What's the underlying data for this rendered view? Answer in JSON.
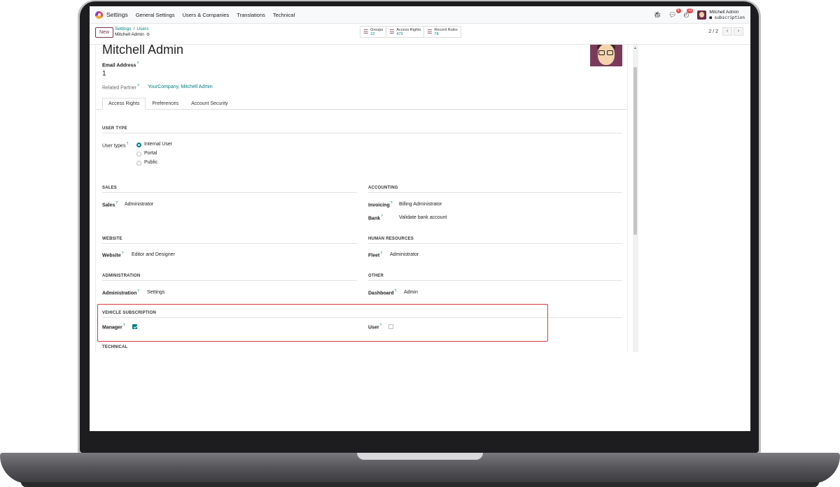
{
  "navbar": {
    "app_title": "Settings",
    "menu": [
      "General Settings",
      "Users & Companies",
      "Translations",
      "Technical"
    ],
    "chat_badge": "6",
    "activity_badge": "11",
    "user_name": "Mitchell Admin",
    "database": "subscription"
  },
  "control": {
    "new_label": "New",
    "breadcrumb_parent_1": "Settings",
    "breadcrumb_parent_2": "Users",
    "breadcrumb_current": "Mitchell Admin",
    "smart_buttons": [
      {
        "label": "Groups",
        "value": "22",
        "icon": "users-icon"
      },
      {
        "label": "Access Rights",
        "value": "473",
        "icon": "list-icon"
      },
      {
        "label": "Record Rules",
        "value": "78",
        "icon": "list-icon"
      }
    ],
    "pager": "2 / 2"
  },
  "form": {
    "name": "Mitchell Admin",
    "email_label": "Email Address",
    "email_value": "1",
    "partner_label": "Related Partner",
    "partner_value": "YourCompany, Mitchell Admin",
    "tabs": [
      "Access Rights",
      "Preferences",
      "Account Security"
    ],
    "active_tab": "Access Rights"
  },
  "access": {
    "user_type_title": "USER TYPE",
    "user_types_label": "User types",
    "user_type_options": [
      "Internal User",
      "Portal",
      "Public"
    ],
    "user_type_selected": "Internal User",
    "sales_title": "SALES",
    "sales_label": "Sales",
    "sales_value": "Administrator",
    "accounting_title": "ACCOUNTING",
    "invoicing_label": "Invoicing",
    "invoicing_value": "Billing Administrator",
    "bank_label": "Bank",
    "bank_value": "Validate bank account",
    "website_title": "WEBSITE",
    "website_label": "Website",
    "website_value": "Editor and Designer",
    "hr_title": "HUMAN RESOURCES",
    "fleet_label": "Fleet",
    "fleet_value": "Administrator",
    "admin_title": "ADMINISTRATION",
    "admin_label": "Administration",
    "admin_value": "Settings",
    "other_title": "OTHER",
    "dashboard_label": "Dashboard",
    "dashboard_value": "Admin",
    "vehicle_title": "VEHICLE SUBSCRIPTION",
    "manager_label": "Manager",
    "manager_checked": true,
    "user_label": "User",
    "user_checked": false,
    "technical_title": "TECHNICAL"
  },
  "colors": {
    "brand": "#71324a",
    "link": "#017e84",
    "highlight": "#e0383b"
  }
}
